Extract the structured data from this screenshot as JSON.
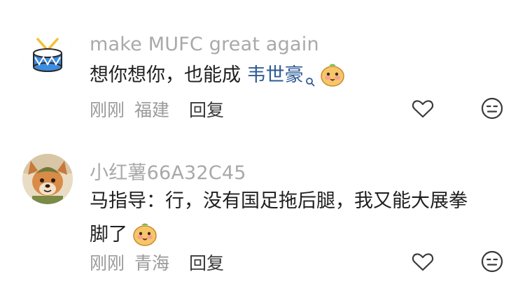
{
  "comments": [
    {
      "username": "make MUFC great again",
      "text_parts": [
        "想你想你，也能成 ",
        "韦世豪"
      ],
      "time": "刚刚",
      "location": "福建",
      "reply_label": "回复",
      "avatar_icon": "drum-icon"
    },
    {
      "username": "小红薯66A32C45",
      "text_line1": "马指导：行，没有国足拖后腿，我又能大展拳",
      "text_line2": "脚了",
      "time": "刚刚",
      "location": "青海",
      "reply_label": "回复",
      "avatar_icon": "fox-character-icon"
    }
  ],
  "colors": {
    "username": "#a9a9a9",
    "text": "#1f1f1f",
    "link": "#2e5a96",
    "meta": "#9a9a9a",
    "reply": "#3a3a3a"
  },
  "icons": {
    "like": "heart-outline-icon",
    "dislike": "neutral-face-icon",
    "emoji": "sticker-emoji-icon"
  }
}
